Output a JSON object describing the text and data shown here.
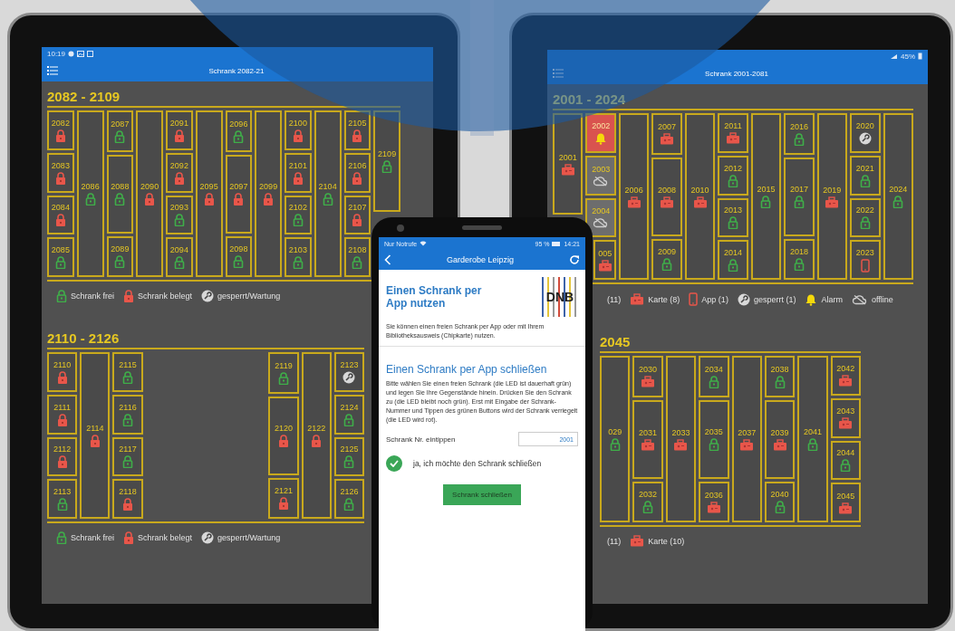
{
  "tablets": [
    {
      "status_bar": {
        "time": "10:19"
      },
      "app_bar": {
        "title": "Schrank 2082-21"
      },
      "sections": [
        {
          "heading": "2082 - 2109",
          "columns": [
            {
              "kind": "stack",
              "cells": [
                {
                  "label": "2082",
                  "kind": "occupied"
                },
                {
                  "label": "2083",
                  "kind": "occupied"
                },
                {
                  "label": "2084",
                  "kind": "occupied"
                },
                {
                  "label": "2085",
                  "kind": "free"
                }
              ]
            },
            {
              "kind": "stack",
              "cells": [
                {
                  "label": "2086",
                  "kind": "free"
                }
              ]
            },
            {
              "kind": "stack",
              "cells": [
                {
                  "label": "2087",
                  "kind": "free"
                },
                {
                  "label": "2088",
                  "kind": "free"
                },
                {
                  "label": "2089",
                  "kind": "free"
                }
              ]
            },
            {
              "kind": "stack",
              "cells": [
                {
                  "label": "2090",
                  "kind": "occupied"
                }
              ]
            },
            {
              "kind": "stack",
              "cells": [
                {
                  "label": "2091",
                  "kind": "occupied"
                },
                {
                  "label": "2092",
                  "kind": "occupied"
                },
                {
                  "label": "2093",
                  "kind": "free"
                },
                {
                  "label": "2094",
                  "kind": "free"
                }
              ]
            },
            {
              "kind": "stack",
              "cells": [
                {
                  "label": "2095",
                  "kind": "occupied"
                }
              ]
            },
            {
              "kind": "stack",
              "cells": [
                {
                  "label": "2096",
                  "kind": "free"
                },
                {
                  "label": "2097",
                  "kind": "occupied"
                },
                {
                  "label": "2098",
                  "kind": "free"
                }
              ]
            },
            {
              "kind": "stack",
              "cells": [
                {
                  "label": "2099",
                  "kind": "occupied"
                }
              ]
            },
            {
              "kind": "stack",
              "cells": [
                {
                  "label": "2100",
                  "kind": "occupied"
                },
                {
                  "label": "2101",
                  "kind": "occupied"
                },
                {
                  "label": "2102",
                  "kind": "free"
                },
                {
                  "label": "2103",
                  "kind": "free"
                }
              ]
            },
            {
              "kind": "stack",
              "cells": [
                {
                  "label": "2104",
                  "kind": "free"
                }
              ]
            },
            {
              "kind": "stack",
              "cells": [
                {
                  "label": "2105",
                  "kind": "occupied"
                },
                {
                  "label": "2106",
                  "kind": "occupied"
                },
                {
                  "label": "2107",
                  "kind": "occupied"
                },
                {
                  "label": "2108",
                  "kind": "free"
                }
              ]
            },
            {
              "kind": "stack",
              "cells": [
                {
                  "label": "2109",
                  "kind": "free"
                }
              ]
            }
          ],
          "legend": [
            {
              "kind": "free",
              "text": "Schrank frei"
            },
            {
              "kind": "occupied",
              "text": "Schrank belegt"
            },
            {
              "kind": "maintenance",
              "text": "gesperrt/Wartung"
            }
          ]
        },
        {
          "heading": "2110 - 2126",
          "columns": [
            {
              "kind": "stack",
              "cells": [
                {
                  "label": "2110",
                  "kind": "occupied"
                },
                {
                  "label": "2111",
                  "kind": "occupied"
                },
                {
                  "label": "2112",
                  "kind": "occupied"
                },
                {
                  "label": "2113",
                  "kind": "free"
                }
              ]
            },
            {
              "kind": "stack",
              "cells": [
                {
                  "label": "2114",
                  "kind": "occupied"
                }
              ]
            },
            {
              "kind": "stack",
              "cells": [
                {
                  "label": "2115",
                  "kind": "free"
                },
                {
                  "label": "2116",
                  "kind": "free"
                },
                {
                  "label": "2117",
                  "kind": "free"
                },
                {
                  "label": "2118",
                  "kind": "occupied"
                }
              ]
            },
            {
              "kind": "gap"
            },
            {
              "kind": "stack",
              "cells": [
                {
                  "label": "2119",
                  "kind": "free"
                },
                {
                  "label": "2120",
                  "kind": "occupied"
                },
                {
                  "label": "2121",
                  "kind": "occupied"
                }
              ]
            },
            {
              "kind": "stack",
              "cells": [
                {
                  "label": "2122",
                  "kind": "occupied"
                }
              ]
            },
            {
              "kind": "stack",
              "cells": [
                {
                  "label": "2123",
                  "kind": "maintenance"
                },
                {
                  "label": "2124",
                  "kind": "free"
                },
                {
                  "label": "2125",
                  "kind": "free"
                },
                {
                  "label": "2126",
                  "kind": "free"
                }
              ]
            }
          ],
          "legend": [
            {
              "kind": "free",
              "text": "Schrank frei"
            },
            {
              "kind": "occupied",
              "text": "Schrank belegt"
            },
            {
              "kind": "maintenance",
              "text": "gesperrt/Wartung"
            }
          ]
        }
      ]
    },
    {
      "status_bar": {
        "battery": "45%"
      },
      "app_bar": {
        "title": "Schrank 2001-2081"
      },
      "sections": [
        {
          "heading": "2001 - 2024",
          "columns": [
            {
              "kind": "stack",
              "cells": [
                {
                  "label": "2001",
                  "kind": "card"
                }
              ]
            },
            {
              "kind": "stack",
              "cells": [
                {
                  "label": "2002",
                  "kind": "alarm"
                },
                {
                  "label": "2003",
                  "kind": "offline"
                },
                {
                  "label": "2004",
                  "kind": "offline"
                },
                {
                  "label": "005",
                  "kind": "card"
                }
              ]
            },
            {
              "kind": "stack",
              "cells": [
                {
                  "label": "2006",
                  "kind": "card"
                }
              ]
            },
            {
              "kind": "stack",
              "cells": [
                {
                  "label": "2007",
                  "kind": "card"
                },
                {
                  "label": "2008",
                  "kind": "card"
                },
                {
                  "label": "2009",
                  "kind": "free"
                }
              ]
            },
            {
              "kind": "stack",
              "cells": [
                {
                  "label": "2010",
                  "kind": "card"
                }
              ]
            },
            {
              "kind": "stack",
              "cells": [
                {
                  "label": "2011",
                  "kind": "card"
                },
                {
                  "label": "2012",
                  "kind": "free"
                },
                {
                  "label": "2013",
                  "kind": "free"
                },
                {
                  "label": "2014",
                  "kind": "free"
                }
              ]
            },
            {
              "kind": "stack",
              "cells": [
                {
                  "label": "2015",
                  "kind": "free"
                }
              ]
            },
            {
              "kind": "stack",
              "cells": [
                {
                  "label": "2016",
                  "kind": "free"
                },
                {
                  "label": "2017",
                  "kind": "free"
                },
                {
                  "label": "2018",
                  "kind": "free"
                }
              ]
            },
            {
              "kind": "stack",
              "cells": [
                {
                  "label": "2019",
                  "kind": "card"
                }
              ]
            },
            {
              "kind": "stack",
              "cells": [
                {
                  "label": "2020",
                  "kind": "maintenance"
                },
                {
                  "label": "2021",
                  "kind": "free"
                },
                {
                  "label": "2022",
                  "kind": "free"
                },
                {
                  "label": "2023",
                  "kind": "app"
                }
              ]
            },
            {
              "kind": "stack",
              "cells": [
                {
                  "label": "2024",
                  "kind": "free"
                }
              ]
            }
          ],
          "legend": [
            {
              "kind": "text",
              "text": "(11)"
            },
            {
              "kind": "card",
              "text": "Karte (8)"
            },
            {
              "kind": "app",
              "text": "App (1)"
            },
            {
              "kind": "maintenance",
              "text": "gesperrt (1)"
            },
            {
              "kind": "alarm",
              "text": "Alarm"
            },
            {
              "kind": "offline",
              "text": "offline"
            }
          ]
        },
        {
          "heading": "2045",
          "columns": [
            {
              "kind": "stack",
              "cells": [
                {
                  "label": "029",
                  "kind": "free"
                }
              ]
            },
            {
              "kind": "stack",
              "cells": [
                {
                  "label": "2030",
                  "kind": "card"
                },
                {
                  "label": "2031",
                  "kind": "card"
                },
                {
                  "label": "2032",
                  "kind": "free"
                }
              ]
            },
            {
              "kind": "stack",
              "cells": [
                {
                  "label": "2033",
                  "kind": "card"
                }
              ]
            },
            {
              "kind": "stack",
              "cells": [
                {
                  "label": "2034",
                  "kind": "free"
                },
                {
                  "label": "2035",
                  "kind": "free"
                },
                {
                  "label": "2036",
                  "kind": "card"
                }
              ]
            },
            {
              "kind": "stack",
              "cells": [
                {
                  "label": "2037",
                  "kind": "card"
                }
              ]
            },
            {
              "kind": "stack",
              "cells": [
                {
                  "label": "2038",
                  "kind": "free"
                },
                {
                  "label": "2039",
                  "kind": "card"
                },
                {
                  "label": "2040",
                  "kind": "free"
                }
              ]
            },
            {
              "kind": "stack",
              "cells": [
                {
                  "label": "2041",
                  "kind": "free"
                }
              ]
            },
            {
              "kind": "stack",
              "cells": [
                {
                  "label": "2042",
                  "kind": "card"
                },
                {
                  "label": "2043",
                  "kind": "card"
                },
                {
                  "label": "2044",
                  "kind": "free"
                },
                {
                  "label": "2045",
                  "kind": "card"
                }
              ]
            }
          ],
          "legend": [
            {
              "kind": "text",
              "text": "(11)"
            },
            {
              "kind": "card",
              "text": "Karte (10)"
            }
          ]
        }
      ]
    }
  ],
  "phone": {
    "status_bar": {
      "carrier": "Nur Notrufe",
      "battery": "95 %",
      "time": "14:21"
    },
    "app_bar": {
      "title": "Garderobe Leipzig"
    },
    "intro": {
      "title": "Einen Schrank per App nutzen",
      "logo_text": "DNB",
      "text": "Sie können einen freien Schrank per App oder mit Ihrem Bibliotheksausweis (Chipkarte) nutzen."
    },
    "close": {
      "title": "Einen Schrank per App schließen",
      "text": "Bitte wählen Sie einen freien Schrank (die LED ist dauerhaft grün) und legen Sie Ihre Gegenstände hinein. Drücken Sie den Schrank zu (die LED bleibt noch grün). Erst mit Eingabe der Schrank-Nummer und Tippen des grünen Buttons wird der Schrank verriegelt (die LED wird rot).",
      "field_label": "Schrank Nr. eintippen",
      "field_value": "2001",
      "confirm": {
        "label": "ja, ich möchte den Schrank schließen",
        "checked": true
      },
      "button": "Schrank schließen"
    }
  }
}
